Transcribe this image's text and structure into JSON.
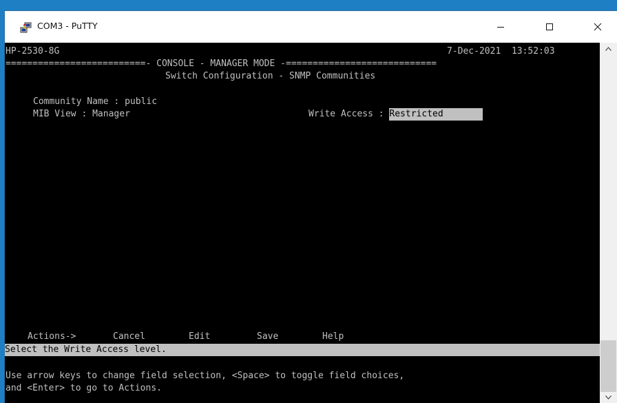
{
  "window": {
    "title": "COM3 - PuTTY",
    "icon": "putty-computers-icon"
  },
  "terminal": {
    "hostname": "HP-2530-8G",
    "date": "7-Dec-2021",
    "time": "13:52:03",
    "mode_banner": "==========================- CONSOLE - MANAGER MODE -============================",
    "screen_title": "Switch Configuration - SNMP Communities",
    "community_label": "Community Name :",
    "community_value": "public",
    "mib_label": "MIB View :",
    "mib_value": "Manager",
    "write_label": "Write Access :",
    "write_value": "Restricted",
    "actions_label": "Actions->",
    "actions": [
      "Cancel",
      "Edit",
      "Save",
      "Help"
    ],
    "status_message": "Select the Write Access level.",
    "help_line1": "Use arrow keys to change field selection, <Space> to toggle field choices,",
    "help_line2": "and <Enter> to go to Actions."
  },
  "colors": {
    "terminal_bg": "#000000",
    "terminal_fg": "#c0c0c0",
    "highlight_bg": "#c0c0c0",
    "desktop": "#1f7fc4"
  }
}
